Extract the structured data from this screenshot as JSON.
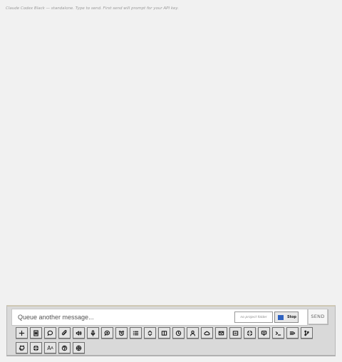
{
  "status_text": "Claude Codex Black — standalone. Type to send. First send will prompt for your API key.",
  "composer": {
    "placeholder": "Queue another message...",
    "folder_label": "no project folder",
    "stop_label": "Stop",
    "send_label": "SEND"
  },
  "colors": {
    "stop_indicator": "#2f62c0",
    "panel": "#d9d9d9",
    "page": "#f1f1f1"
  },
  "toolbar_icons": [
    "plus-icon",
    "document-icon",
    "chat-bubble-icon",
    "paperclip-icon",
    "speaker-icon",
    "microphone-icon",
    "chat-search-icon",
    "alarm-clock-icon",
    "list-icon",
    "expand-collapse-icon",
    "columns-icon",
    "timer-icon",
    "person-icon",
    "cloud-icon",
    "mail-icon",
    "folder-icon",
    "globe-icon",
    "speech-bubble-icon",
    "terminal-icon",
    "queue-list-icon",
    "git-branch-icon",
    "github-icon",
    "globe-grid-icon",
    "font-size-icon",
    "help-icon",
    "settings-icon"
  ],
  "toolbar_text": {
    "font_size": "A",
    "font_size_small": "A"
  }
}
